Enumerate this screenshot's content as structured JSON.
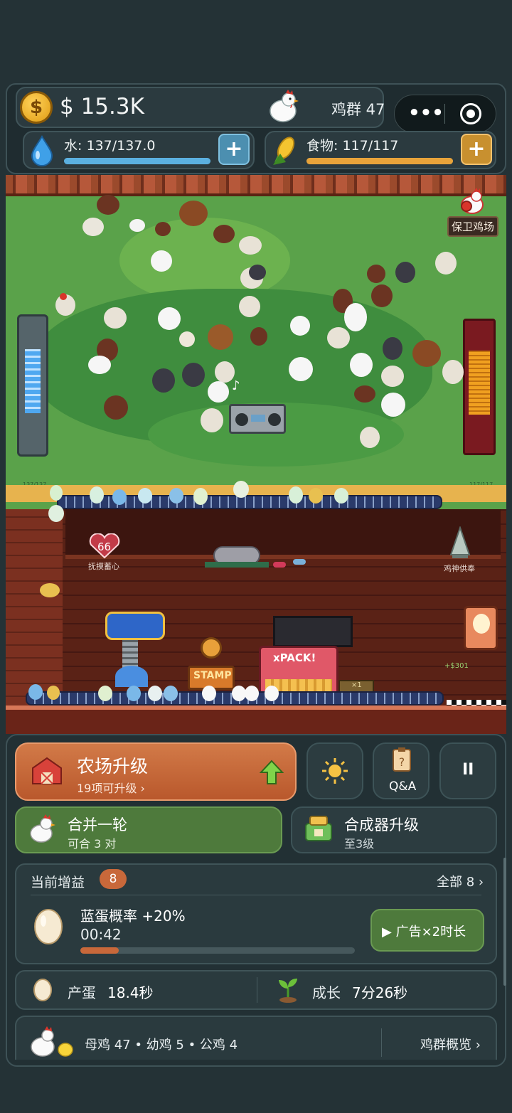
{
  "hud": {
    "money": "$ 15.3K",
    "flock": "鸡群 47",
    "water_label": "水: 137/137.0",
    "water_fill": 1.0,
    "food_label": "食物: 117/117",
    "food_fill": 1.0,
    "plus": "+"
  },
  "capsule": {
    "more": "•••"
  },
  "scene": {
    "defend": "保卫鸡场",
    "water_tiny": "137/137",
    "food_tiny": "117/117",
    "heart_value": "66",
    "heart_label": "抚摸蓄心",
    "shrine_label": "鸡神供奉",
    "income": "+$301",
    "pack_label": "xPACK!",
    "stamp_label": "STAMP",
    "tray_label": "×1"
  },
  "actions": {
    "upgrade_title": "农场升级",
    "upgrade_sub": "19项可升级 ›",
    "qa": "Q&A",
    "pause": "II",
    "merge_title": "合并一轮",
    "merge_sub": "可合 3 对",
    "synth_title": "合成器升级",
    "synth_sub": "至3级"
  },
  "buffs": {
    "header": "当前增益",
    "count": "8",
    "all": "全部 8 ›",
    "item_title": "蓝蛋概率 +20%",
    "item_time": "00:42",
    "item_progress": 0.14,
    "ad_button": "▶ 广告×2时长"
  },
  "stats": {
    "egg_label": "产蛋",
    "egg_value": "18.4秒",
    "grow_label": "成长",
    "grow_value": "7分26秒"
  },
  "flock": {
    "summary": "母鸡 47 • 幼鸡 5 • 公鸡 4",
    "overview": "鸡群概览 ›"
  },
  "colors": {
    "accent_orange": "#c8683a",
    "accent_green": "#4e7a3c",
    "water_blue": "#5bb0e0",
    "food_gold": "#e8a33a"
  }
}
